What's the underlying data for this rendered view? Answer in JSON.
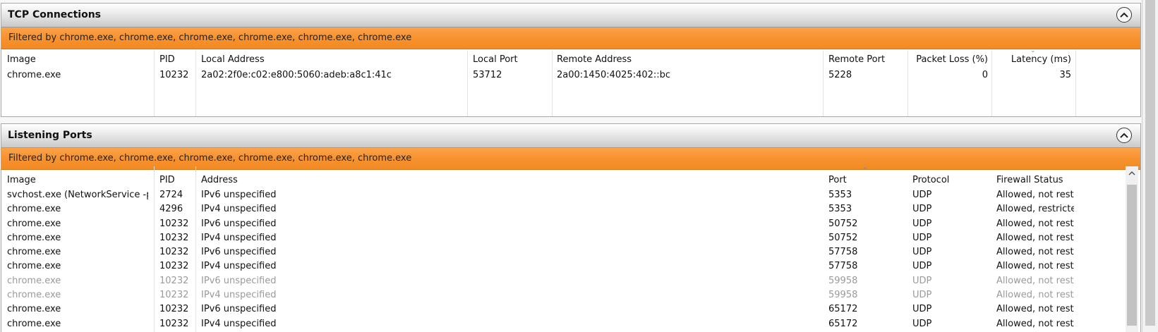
{
  "tcp": {
    "title": "TCP Connections",
    "filter": "Filtered by chrome.exe, chrome.exe, chrome.exe, chrome.exe, chrome.exe, chrome.exe",
    "columns": {
      "image": "Image",
      "pid": "PID",
      "local_address": "Local Address",
      "local_port": "Local Port",
      "remote_address": "Remote Address",
      "remote_port": "Remote Port",
      "packet_loss": "Packet Loss (%)",
      "latency": "Latency (ms)"
    },
    "rows": [
      {
        "image": "chrome.exe",
        "pid": "10232",
        "local_address": "2a02:2f0e:c02:e800:5060:adeb:a8c1:41c",
        "local_port": "53712",
        "remote_address": "2a00:1450:4025:402::bc",
        "remote_port": "5228",
        "packet_loss": "0",
        "latency": "35"
      }
    ]
  },
  "listen": {
    "title": "Listening Ports",
    "filter": "Filtered by chrome.exe, chrome.exe, chrome.exe, chrome.exe, chrome.exe, chrome.exe",
    "columns": {
      "image": "Image",
      "pid": "PID",
      "address": "Address",
      "port": "Port",
      "protocol": "Protocol",
      "firewall": "Firewall Status"
    },
    "rows": [
      {
        "image": "svchost.exe (NetworkService -p)",
        "pid": "2724",
        "address": "IPv6 unspecified",
        "port": "5353",
        "protocol": "UDP",
        "firewall": "Allowed, not rest...",
        "dim": false
      },
      {
        "image": "chrome.exe",
        "pid": "4296",
        "address": "IPv4 unspecified",
        "port": "5353",
        "protocol": "UDP",
        "firewall": "Allowed, restricted",
        "dim": false
      },
      {
        "image": "chrome.exe",
        "pid": "10232",
        "address": "IPv6 unspecified",
        "port": "50752",
        "protocol": "UDP",
        "firewall": "Allowed, not rest...",
        "dim": false
      },
      {
        "image": "chrome.exe",
        "pid": "10232",
        "address": "IPv4 unspecified",
        "port": "50752",
        "protocol": "UDP",
        "firewall": "Allowed, not rest...",
        "dim": false
      },
      {
        "image": "chrome.exe",
        "pid": "10232",
        "address": "IPv6 unspecified",
        "port": "57758",
        "protocol": "UDP",
        "firewall": "Allowed, not rest...",
        "dim": false
      },
      {
        "image": "chrome.exe",
        "pid": "10232",
        "address": "IPv4 unspecified",
        "port": "57758",
        "protocol": "UDP",
        "firewall": "Allowed, not rest...",
        "dim": false
      },
      {
        "image": "chrome.exe",
        "pid": "10232",
        "address": "IPv6 unspecified",
        "port": "59958",
        "protocol": "UDP",
        "firewall": "Allowed, not rest...",
        "dim": true
      },
      {
        "image": "chrome.exe",
        "pid": "10232",
        "address": "IPv4 unspecified",
        "port": "59958",
        "protocol": "UDP",
        "firewall": "Allowed, not rest...",
        "dim": true
      },
      {
        "image": "chrome.exe",
        "pid": "10232",
        "address": "IPv6 unspecified",
        "port": "65172",
        "protocol": "UDP",
        "firewall": "Allowed, not rest...",
        "dim": false
      },
      {
        "image": "chrome.exe",
        "pid": "10232",
        "address": "IPv4 unspecified",
        "port": "65172",
        "protocol": "UDP",
        "firewall": "Allowed, not rest...",
        "dim": false
      }
    ]
  },
  "colors": {
    "filter_bar": "#f7922f",
    "header_gradient_bottom": "#c9c9c9",
    "dim_text": "#9a9a9a"
  },
  "icons": {
    "collapse": "chevron-up-icon",
    "scroll_up": "scroll-up-arrow-icon",
    "scroll_down": "scroll-down-arrow-icon",
    "sort": "sort-caret-icon"
  }
}
